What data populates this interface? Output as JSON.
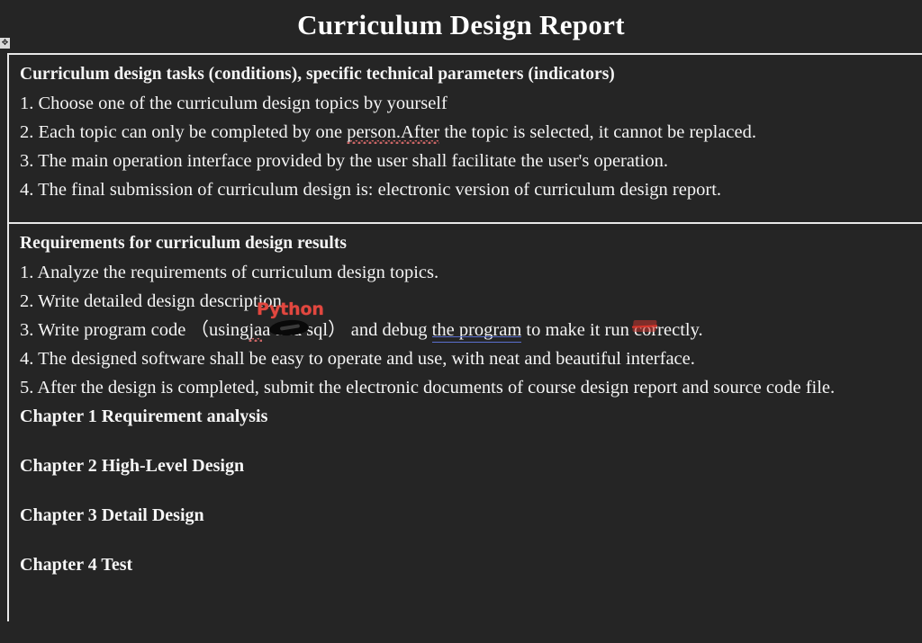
{
  "document": {
    "title": "Curriculum Design Report",
    "icon_table_handle": "table-move-handle-icon"
  },
  "sections": [
    {
      "heading": "Curriculum design tasks (conditions), specific technical parameters (indicators)",
      "items": [
        "1. Choose one of the curriculum design topics by yourself",
        "2. Each topic can only be completed by one person.After the topic is selected, it cannot be replaced.",
        "3. The main operation interface provided by the user shall facilitate the user's operation.",
        "4. The final submission of curriculum design is: electronic version of curriculum design report."
      ]
    },
    {
      "heading": "Requirements for curriculum design results",
      "items": [
        "1. Analyze the requirements of curriculum design topics.",
        "2. Write detailed design description.",
        "4. The designed software shall be easy to operate and use, with neat and beautiful interface.",
        "5. After the design is completed, submit the electronic documents of course design report and source code file."
      ]
    }
  ],
  "annotated_line": {
    "prefix": "3. Write program code  （using",
    "redacted_word": "ja",
    "middle": "a and sql） and debug ",
    "double_underlined": "the   program",
    "suffix_before_mark": " to make it run ",
    "marked_text": "co",
    "suffix_after_mark": "rrectly.",
    "ink_annotation": "Python"
  },
  "spell_errors": {
    "line2_misspelled": "person.After",
    "line3_misspelled": "a"
  },
  "chapters": [
    "Chapter 1 Requirement analysis",
    "Chapter 2 High-Level Design",
    "Chapter 3 Detail Design",
    "Chapter 4 Test"
  ],
  "colors": {
    "page_background": "#252525",
    "text": "#f4f4f4",
    "table_border": "#e8e8e8",
    "ink_red": "#e2473f",
    "underline_blue": "#5a6fd0",
    "spellcheck_red": "#d46a6a"
  }
}
